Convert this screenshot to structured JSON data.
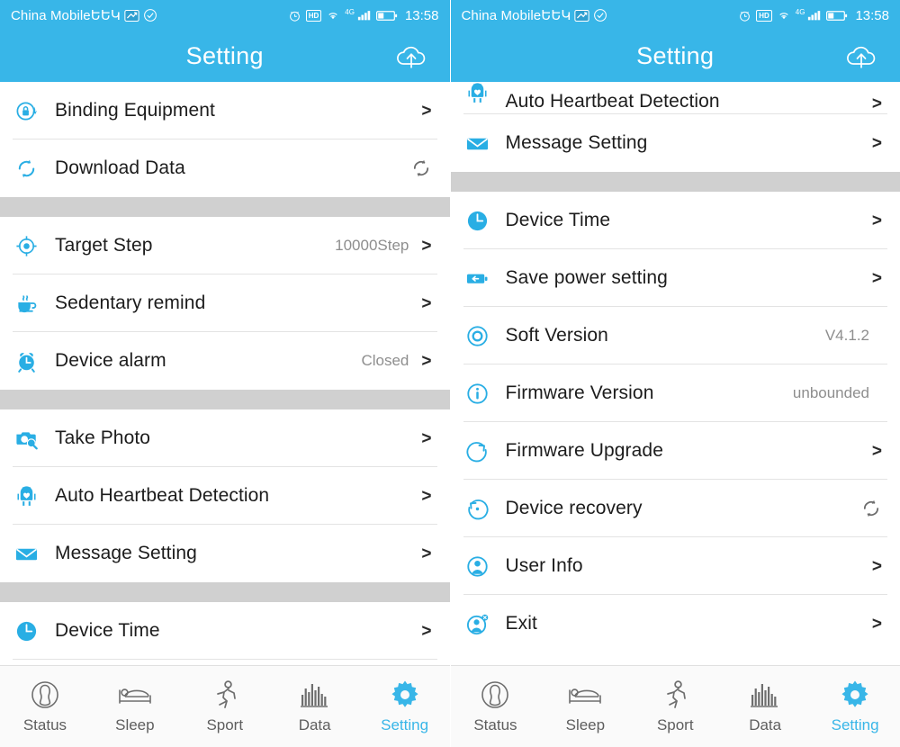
{
  "theme": {
    "accent": "#38b6e8",
    "band": "#d0d0d0",
    "text": "#1c1c1c",
    "value_text": "#8e8e8e",
    "tab_inactive": "#5e5e5e"
  },
  "status_bar": {
    "carrier": "China MobileԵԵԿ",
    "time": "13:58",
    "hd_label": "HD",
    "network_label": "4G"
  },
  "header": {
    "title": "Setting",
    "upload_icon": "cloud-upload-icon"
  },
  "left_screen": {
    "groups": [
      {
        "rows": [
          {
            "icon": "lock-sync-icon",
            "label": "Binding Equipment",
            "value": "",
            "accessory": "chevron"
          },
          {
            "icon": "refresh-circle-icon",
            "label": "Download Data",
            "value": "",
            "accessory": "refresh"
          }
        ]
      },
      {
        "rows": [
          {
            "icon": "target-icon",
            "label": "Target Step",
            "value": "10000Step",
            "accessory": "chevron"
          },
          {
            "icon": "coffee-cup-icon",
            "label": "Sedentary remind",
            "value": "",
            "accessory": "chevron"
          },
          {
            "icon": "alarm-clock-icon",
            "label": "Device alarm",
            "value": "Closed",
            "accessory": "chevron"
          }
        ]
      },
      {
        "rows": [
          {
            "icon": "camera-icon",
            "label": "Take Photo",
            "value": "",
            "accessory": "chevron"
          },
          {
            "icon": "heartbeat-robot-icon",
            "label": "Auto Heartbeat Detection",
            "value": "",
            "accessory": "chevron"
          },
          {
            "icon": "envelope-icon",
            "label": "Message Setting",
            "value": "",
            "accessory": "chevron"
          }
        ]
      },
      {
        "rows": [
          {
            "icon": "clock-icon",
            "label": "Device Time",
            "value": "",
            "accessory": "chevron"
          }
        ]
      }
    ]
  },
  "right_screen": {
    "partial_top_row": {
      "icon": "heartbeat-robot-icon",
      "label": "Auto Heartbeat Detection",
      "value": "",
      "accessory": "chevron"
    },
    "groups": [
      {
        "rows": [
          {
            "icon": "envelope-icon",
            "label": "Message Setting",
            "value": "",
            "accessory": "chevron"
          }
        ]
      },
      {
        "rows": [
          {
            "icon": "clock-icon",
            "label": "Device Time",
            "value": "",
            "accessory": "chevron"
          },
          {
            "icon": "battery-save-icon",
            "label": "Save power setting",
            "value": "",
            "accessory": "chevron"
          },
          {
            "icon": "circle-dot-icon",
            "label": "Soft Version",
            "value": "V4.1.2",
            "accessory": "none"
          },
          {
            "icon": "info-icon",
            "label": "Firmware Version",
            "value": "unbounded",
            "accessory": "none"
          },
          {
            "icon": "upgrade-circle-icon",
            "label": "Firmware Upgrade",
            "value": "",
            "accessory": "chevron"
          },
          {
            "icon": "restore-icon",
            "label": "Device recovery",
            "value": "",
            "accessory": "refresh"
          },
          {
            "icon": "user-icon",
            "label": "User Info",
            "value": "",
            "accessory": "chevron"
          },
          {
            "icon": "user-exit-icon",
            "label": "Exit",
            "value": "",
            "accessory": "chevron"
          }
        ]
      }
    ]
  },
  "tabbar": {
    "items": [
      {
        "icon": "status-person-icon",
        "label": "Status",
        "active": false
      },
      {
        "icon": "bed-icon",
        "label": "Sleep",
        "active": false
      },
      {
        "icon": "running-icon",
        "label": "Sport",
        "active": false
      },
      {
        "icon": "bar-chart-icon",
        "label": "Data",
        "active": false
      },
      {
        "icon": "gear-icon",
        "label": "Setting",
        "active": true
      }
    ]
  }
}
